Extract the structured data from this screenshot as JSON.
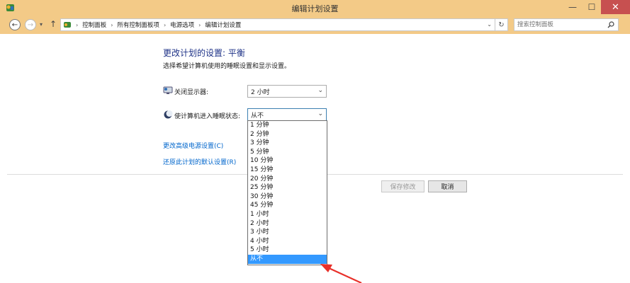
{
  "window": {
    "title": "编辑计划设置",
    "minimize_glyph": "—",
    "maximize_glyph": "☐",
    "close_glyph": "✕"
  },
  "address_bar": {
    "breadcrumbs": [
      "控制面板",
      "所有控制面板项",
      "电源选项",
      "编辑计划设置"
    ],
    "separator": "›",
    "search_placeholder": "搜索控制面板"
  },
  "content": {
    "title": "更改计划的设置: 平衡",
    "subtitle": "选择希望计算机使用的睡眠设置和显示设置。",
    "display_off": {
      "label": "关闭显示器:",
      "value": "2 小时"
    },
    "sleep": {
      "label": "使计算机进入睡眠状态:",
      "value": "从不",
      "options": [
        "1 分钟",
        "2 分钟",
        "3 分钟",
        "5 分钟",
        "10 分钟",
        "15 分钟",
        "20 分钟",
        "25 分钟",
        "30 分钟",
        "45 分钟",
        "1 小时",
        "2 小时",
        "3 小时",
        "4 小时",
        "5 小时",
        "从不"
      ],
      "highlighted_index": 15
    },
    "links": {
      "advanced": "更改高级电源设置(C)",
      "restore": "还原此计划的默认设置(R)"
    },
    "buttons": {
      "save": "保存修改",
      "cancel": "取消"
    }
  },
  "colors": {
    "titlebar": "#f3ca87",
    "close": "#c75050",
    "link": "#0066cc",
    "heading": "#1e3287",
    "selection": "#3399ff",
    "arrow": "#e8302a"
  },
  "icons": {
    "app": "control-panel-icon",
    "display": "monitor-icon",
    "sleep": "moon-icon",
    "search": "magnifier-icon",
    "refresh": "refresh-icon"
  }
}
